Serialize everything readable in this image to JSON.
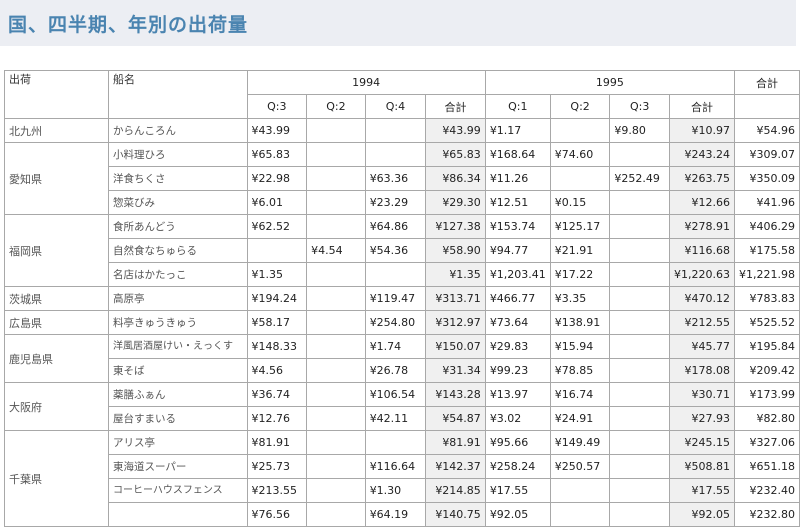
{
  "page": {
    "title": "国、四半期、年別の出荷量"
  },
  "table": {
    "corner_country": "出荷",
    "corner_ship": "船名",
    "year1": "1994",
    "year2": "1995",
    "grand_total": "合計",
    "quarters1": [
      "Q:3",
      "Q:2",
      "Q:4",
      "合計"
    ],
    "quarters2": [
      "Q:1",
      "Q:2",
      "Q:3",
      "合計"
    ],
    "rows": [
      {
        "region": "北九州",
        "ship": "からんころん",
        "cells": [
          "¥43.99",
          "",
          "",
          "¥43.99",
          "¥1.17",
          "",
          "¥9.80",
          "¥10.97",
          "¥54.96"
        ]
      },
      {
        "region": "愛知県",
        "ship": "小料理ひろ",
        "cells": [
          "¥65.83",
          "",
          "",
          "¥65.83",
          "¥168.64",
          "¥74.60",
          "",
          "¥243.24",
          "¥309.07"
        ]
      },
      {
        "region": "",
        "ship": "洋食ちくさ",
        "cells": [
          "¥22.98",
          "",
          "¥63.36",
          "¥86.34",
          "¥11.26",
          "",
          "¥252.49",
          "¥263.75",
          "¥350.09"
        ]
      },
      {
        "region": "",
        "ship": "惣菜びみ",
        "cells": [
          "¥6.01",
          "",
          "¥23.29",
          "¥29.30",
          "¥12.51",
          "¥0.15",
          "",
          "¥12.66",
          "¥41.96"
        ]
      },
      {
        "region": "福岡県",
        "ship": "食所あんどう",
        "cells": [
          "¥62.52",
          "",
          "¥64.86",
          "¥127.38",
          "¥153.74",
          "¥125.17",
          "",
          "¥278.91",
          "¥406.29"
        ]
      },
      {
        "region": "",
        "ship": "自然食なちゅらる",
        "cells": [
          "",
          "¥4.54",
          "¥54.36",
          "¥58.90",
          "¥94.77",
          "¥21.91",
          "",
          "¥116.68",
          "¥175.58"
        ]
      },
      {
        "region": "",
        "ship": "名店はかたっこ",
        "cells": [
          "¥1.35",
          "",
          "",
          "¥1.35",
          "¥1,203.41",
          "¥17.22",
          "",
          "¥1,220.63",
          "¥1,221.98"
        ]
      },
      {
        "region": "茨城県",
        "ship": "高原亭",
        "cells": [
          "¥194.24",
          "",
          "¥119.47",
          "¥313.71",
          "¥466.77",
          "¥3.35",
          "",
          "¥470.12",
          "¥783.83"
        ]
      },
      {
        "region": "広島県",
        "ship": "料亭きゅうきゅう",
        "cells": [
          "¥58.17",
          "",
          "¥254.80",
          "¥312.97",
          "¥73.64",
          "¥138.91",
          "",
          "¥212.55",
          "¥525.52"
        ]
      },
      {
        "region": "鹿児島県",
        "ship": "洋風居酒屋けい・えっくす",
        "cells": [
          "¥148.33",
          "",
          "¥1.74",
          "¥150.07",
          "¥29.83",
          "¥15.94",
          "",
          "¥45.77",
          "¥195.84"
        ]
      },
      {
        "region": "",
        "ship": "東そば",
        "cells": [
          "¥4.56",
          "",
          "¥26.78",
          "¥31.34",
          "¥99.23",
          "¥78.85",
          "",
          "¥178.08",
          "¥209.42"
        ]
      },
      {
        "region": "大阪府",
        "ship": "薬膳ふぁん",
        "cells": [
          "¥36.74",
          "",
          "¥106.54",
          "¥143.28",
          "¥13.97",
          "¥16.74",
          "",
          "¥30.71",
          "¥173.99"
        ]
      },
      {
        "region": "",
        "ship": "屋台すまいる",
        "cells": [
          "¥12.76",
          "",
          "¥42.11",
          "¥54.87",
          "¥3.02",
          "¥24.91",
          "",
          "¥27.93",
          "¥82.80"
        ]
      },
      {
        "region": "千葉県",
        "ship": "アリス亭",
        "cells": [
          "¥81.91",
          "",
          "",
          "¥81.91",
          "¥95.66",
          "¥149.49",
          "",
          "¥245.15",
          "¥327.06"
        ]
      },
      {
        "region": "",
        "ship": "東海道スーパー",
        "cells": [
          "¥25.73",
          "",
          "¥116.64",
          "¥142.37",
          "¥258.24",
          "¥250.57",
          "",
          "¥508.81",
          "¥651.18"
        ]
      },
      {
        "region": "",
        "ship": "コーヒーハウスフェンス",
        "cells": [
          "¥213.55",
          "",
          "¥1.30",
          "¥214.85",
          "¥17.55",
          "",
          "",
          "¥17.55",
          "¥232.40"
        ]
      },
      {
        "region": "",
        "ship": "",
        "cells": [
          "¥76.56",
          "",
          "¥64.19",
          "¥140.75",
          "¥92.05",
          "",
          "",
          "¥92.05",
          "¥232.80"
        ]
      }
    ]
  }
}
